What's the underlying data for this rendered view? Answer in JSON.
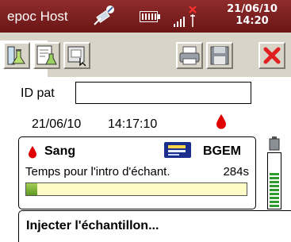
{
  "titlebar": {
    "app_title": "epoc Host",
    "date": "21/06/10",
    "time": "14:20"
  },
  "patient": {
    "id_label": "ID pat",
    "id_value": "",
    "date": "21/06/10",
    "time": "14:17:10"
  },
  "panel": {
    "sample_type": "Sang",
    "card_type": "BGEM",
    "timer_label": "Temps pour l'intro d'échant.",
    "timer_value": "284s",
    "progress_fraction": 0.05
  },
  "level_meter": {
    "filled_bars": 9,
    "total_bars": 9
  },
  "message": "Injecter l'échantillon...",
  "colors": {
    "titlebar": "#7d1f1f",
    "drop": "#e00000",
    "progress_fill": "#7cb342",
    "progress_track": "#fffcc8",
    "meter_bar": "#2f9b2f",
    "close_icon": "#e02020"
  },
  "icons": {
    "titlebar": [
      "connection-icon",
      "battery-icon",
      "signal-icon"
    ],
    "toolbar": [
      "lab-test-icon",
      "document-flask-icon",
      "config-icon",
      "printer-icon",
      "save-icon",
      "close-icon"
    ]
  }
}
